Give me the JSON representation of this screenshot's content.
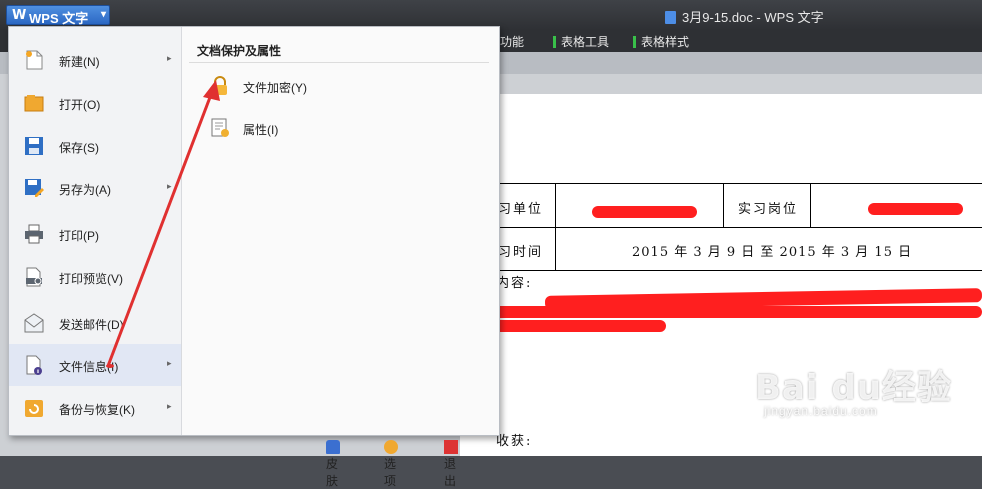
{
  "app": {
    "logo_glyph": "W",
    "button_label": "WPS 文字",
    "button_arrow": "▾",
    "window_title": "3月9-15.doc - WPS 文字"
  },
  "ribbon": {
    "tabs": [
      {
        "label": "功能"
      },
      {
        "label": "表格工具"
      },
      {
        "label": "表格样式"
      }
    ]
  },
  "menu": {
    "items": [
      {
        "label": "新建(N)",
        "icon": "new-document-icon",
        "has_submenu": true
      },
      {
        "label": "打开(O)",
        "icon": "open-folder-icon",
        "has_submenu": false
      },
      {
        "label": "保存(S)",
        "icon": "save-disk-icon",
        "has_submenu": false
      },
      {
        "label": "另存为(A)",
        "icon": "save-as-icon",
        "has_submenu": true
      },
      {
        "label": "打印(P)",
        "icon": "printer-icon",
        "has_submenu": false
      },
      {
        "label": "打印预览(V)",
        "icon": "print-preview-icon",
        "has_submenu": false
      },
      {
        "label": "发送邮件(D)",
        "icon": "mail-icon",
        "has_submenu": false
      },
      {
        "label": "文件信息(I)",
        "icon": "file-info-icon",
        "has_submenu": true,
        "active": true
      },
      {
        "label": "备份与恢复(K)",
        "icon": "backup-icon",
        "has_submenu": true
      }
    ],
    "submenu_arrow": "▸",
    "submenu": {
      "title": "文档保护及属性",
      "items": [
        {
          "label": "文件加密(Y)",
          "icon": "lock-icon"
        },
        {
          "label": "属性(I)",
          "icon": "properties-icon"
        }
      ]
    },
    "footer": [
      {
        "label": "皮肤",
        "icon": "skin-icon"
      },
      {
        "label": "选项",
        "icon": "options-gear-icon"
      },
      {
        "label": "退出",
        "icon": "exit-icon"
      }
    ]
  },
  "document": {
    "row1_label": "习单位",
    "row1_label2": "实习岗位",
    "row2_label": "习时间",
    "row2_value": "2015 年 3 月 9 日 至 2015 年 3 月 15 日",
    "content_label": "内容:",
    "harvest_label": "收获:"
  },
  "watermark": {
    "brand": "Bai du经验",
    "url": "jingyan.baidu.com"
  },
  "colors": {
    "accent": "#2c68c4",
    "annotation": "#e03030",
    "ribbon_mark": "#39c04a"
  }
}
